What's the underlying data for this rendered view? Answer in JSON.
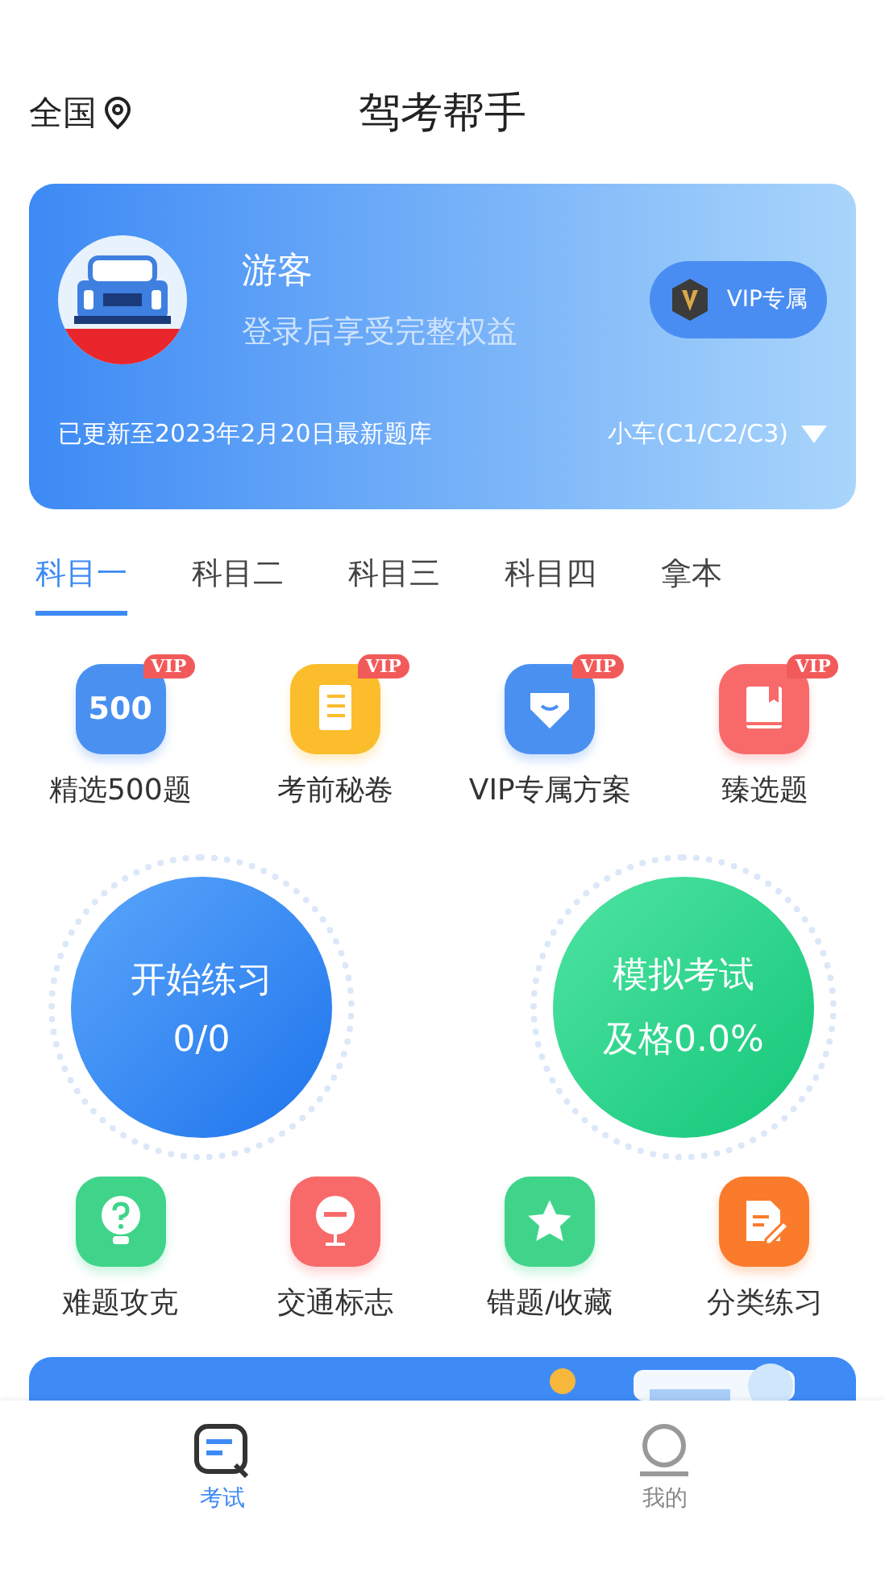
{
  "header": {
    "region": "全国",
    "title": "驾考帮手"
  },
  "profile": {
    "name": "游客",
    "subtitle": "登录后享受完整权益",
    "vip_button": "VIP专属",
    "update_note": "已更新至2023年2月20日最新题库",
    "vehicle": "小车(C1/C2/C3)"
  },
  "tabs": [
    {
      "label": "科目一",
      "selected": true
    },
    {
      "label": "科目二",
      "selected": false
    },
    {
      "label": "科目三",
      "selected": false
    },
    {
      "label": "科目四",
      "selected": false
    },
    {
      "label": "拿本",
      "selected": false
    }
  ],
  "vip_features": [
    {
      "label": "精选500题",
      "badge": "VIP",
      "kind": "five-hundred",
      "color": "#4a90f0",
      "icon_text": "500"
    },
    {
      "label": "考前秘卷",
      "badge": "VIP",
      "kind": "scroll",
      "color": "#fbbd2c"
    },
    {
      "label": "VIP专属方案",
      "badge": "VIP",
      "kind": "diamond",
      "color": "#4a90f0"
    },
    {
      "label": "臻选题",
      "badge": "VIP",
      "kind": "book",
      "color": "#f86a6a"
    }
  ],
  "practice": {
    "title": "开始练习",
    "value": "0/0"
  },
  "exam": {
    "title": "模拟考试",
    "value": "及格0.0%"
  },
  "tools": [
    {
      "label": "难题攻克",
      "kind": "bulb",
      "color": "#3fd48a"
    },
    {
      "label": "交通标志",
      "kind": "sign",
      "color": "#f86a6a"
    },
    {
      "label": "错题/收藏",
      "kind": "star",
      "color": "#3fd48a"
    },
    {
      "label": "分类练习",
      "kind": "note",
      "color": "#fb7b2c"
    }
  ],
  "bottom_nav": [
    {
      "label": "考试",
      "kind": "exam",
      "selected": true
    },
    {
      "label": "我的",
      "kind": "me",
      "selected": false
    }
  ]
}
